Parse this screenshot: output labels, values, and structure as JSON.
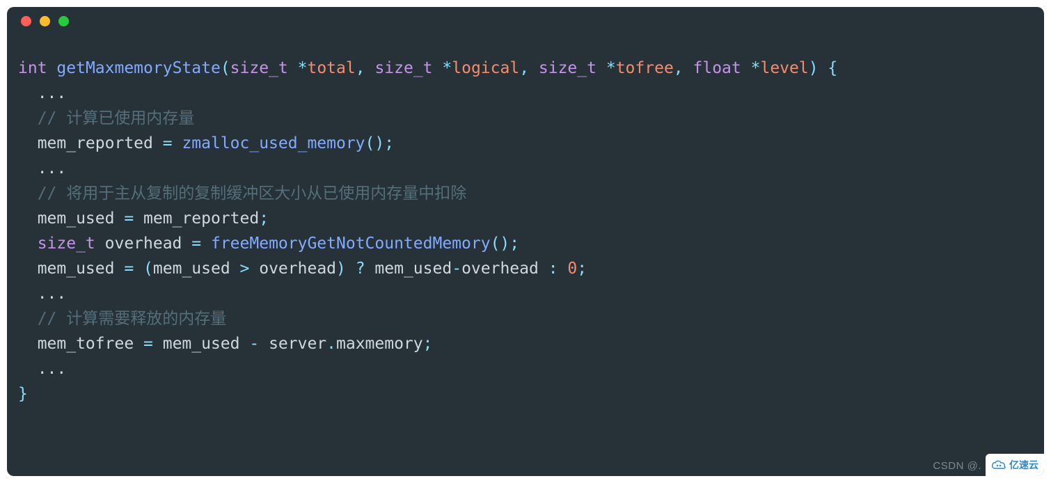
{
  "code": {
    "l1": {
      "kw_int": "int",
      "fn": "getMaxmemoryState",
      "p_open": "(",
      "t1": "size_t",
      "s1": "*",
      "a1": "total",
      "c1": ", ",
      "t2": "size_t",
      "s2": "*",
      "a2": "logical",
      "c2": ", ",
      "t3": "size_t",
      "s3": "*",
      "a3": "tofree",
      "c3": ", ",
      "t4": "float",
      "s4": "*",
      "a4": "level",
      "p_close": ") {"
    },
    "l2": "  ...",
    "l3": "  // 计算已使用内存量",
    "l4": {
      "lhs": "  mem_reported ",
      "eq": "=",
      "sp": " ",
      "call": "zmalloc_used_memory",
      "paren": "()",
      "semi": ";"
    },
    "l5": "  ...",
    "l6": "  // 将用于主从复制的复制缓冲区大小从已使用内存量中扣除",
    "l7": {
      "txt": "  mem_used ",
      "eq": "=",
      "rhs": " mem_reported",
      "semi": ";"
    },
    "l8": {
      "type": "  size_t",
      "var": " overhead ",
      "eq": "=",
      "sp": " ",
      "call": "freeMemoryGetNotCountedMemory",
      "paren": "()",
      "semi": ";"
    },
    "l9": {
      "lhs": "  mem_used ",
      "eq": "=",
      "sp": " ",
      "po": "(",
      "a": "mem_used ",
      "gt": ">",
      "b": " overhead",
      "pc": ")",
      "q": " ? ",
      "c": "mem_used",
      "minus": "-",
      "d": "overhead ",
      "colon": ":",
      "sp2": " ",
      "zero": "0",
      "semi": ";"
    },
    "l10": "  ...",
    "l11": "  // 计算需要释放的内存量",
    "l12": {
      "lhs": "  mem_tofree ",
      "eq": "=",
      "mid": " mem_used ",
      "minus": "-",
      "obj": " server",
      "dot": ".",
      "prop": "maxmemory",
      "semi": ";"
    },
    "l13": "  ...",
    "l14": "}"
  },
  "watermark": "CSDN @.",
  "badge_text": "亿速云"
}
